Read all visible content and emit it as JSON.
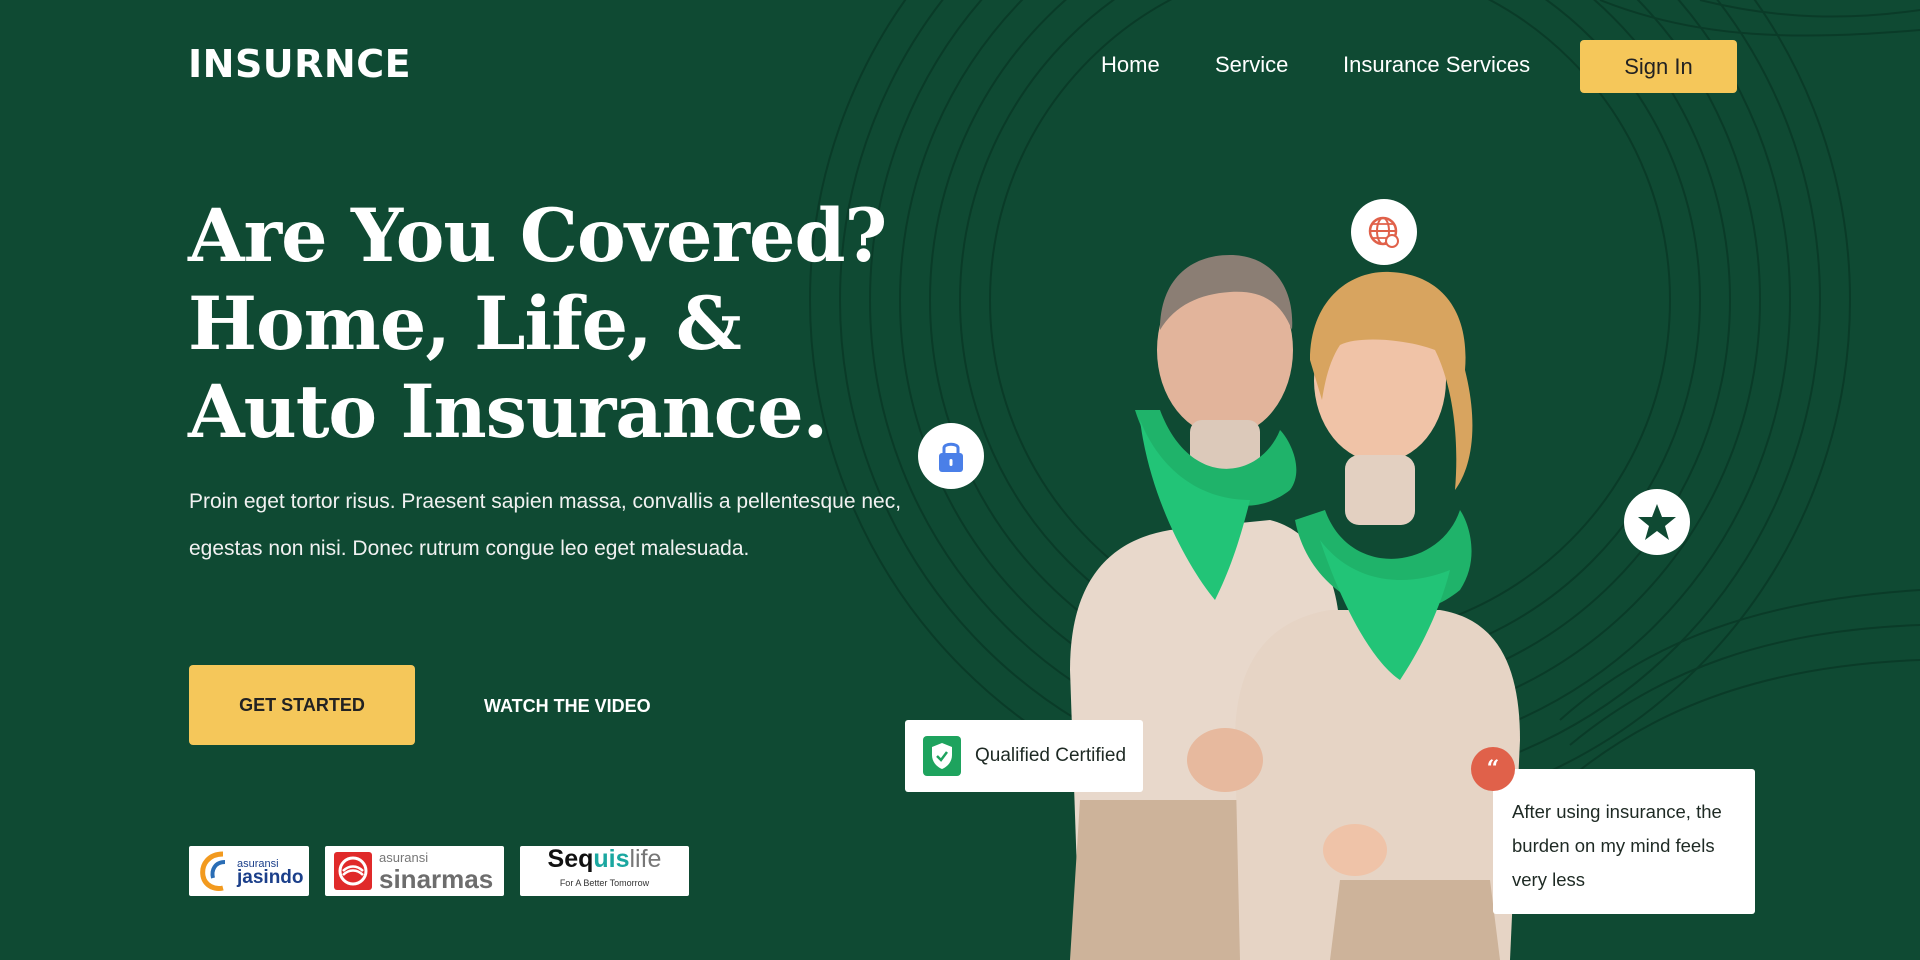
{
  "brand": {
    "name": "INSURNCE"
  },
  "nav": {
    "items": [
      {
        "label": "Home"
      },
      {
        "label": "Service"
      },
      {
        "label": "Insurance Services"
      }
    ],
    "signin_label": "Sign In"
  },
  "hero": {
    "headline": [
      "Are You Covered?",
      "Home, Life, &",
      "Auto Insurance."
    ],
    "description": "Proin eget tortor risus. Praesent sapien massa, convallis a pellentesque nec, egestas non nisi. Donec rutrum congue leo eget malesuada.",
    "cta_primary": "GET STARTED",
    "cta_secondary": "WATCH THE VIDEO"
  },
  "partners": [
    {
      "small": "asuransi",
      "name": "jasindo"
    },
    {
      "small": "asuransi",
      "name": "sinarmas"
    },
    {
      "name_a": "Seq",
      "name_b": "uis",
      "name_c": "life",
      "tagline": "For A Better Tomorrow"
    }
  ],
  "badges": {
    "certified_label": "Qualified Certified",
    "testimonial": "After using insurance, the burden on my mind feels very less",
    "quote_mark": "“"
  },
  "icons": [
    "globe-icon",
    "lock-icon",
    "star-icon",
    "shield-check-icon",
    "quote-icon"
  ],
  "colors": {
    "background": "#0f4a33",
    "accent": "#f5c75a",
    "scarf_green": "#1fb36a",
    "quote_red": "#e0614a",
    "lock_blue": "#4a7fe8"
  }
}
